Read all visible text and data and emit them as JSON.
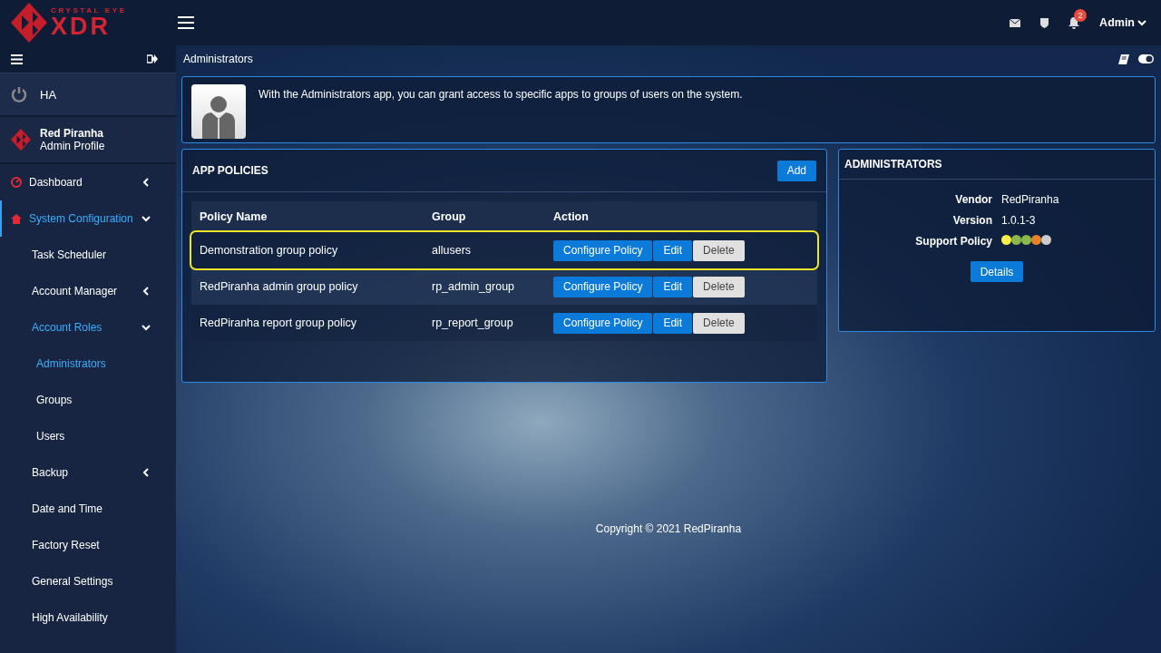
{
  "header": {
    "logo_top": "CRYSTAL EYE",
    "logo_main": "XDR",
    "notifications": "2",
    "user": "Admin"
  },
  "sidebar": {
    "ha": "HA",
    "profile": {
      "name": "Red Piranha",
      "role": "Admin Profile"
    },
    "items": [
      {
        "label": "Dashboard",
        "expanded": false,
        "selected": false
      },
      {
        "label": "System Configuration",
        "expanded": true,
        "selected": true,
        "children": [
          {
            "label": "Task Scheduler",
            "selected": false
          },
          {
            "label": "Account Manager",
            "expanded": false,
            "selected": false
          },
          {
            "label": "Account Roles",
            "expanded": true,
            "selected": true,
            "children": [
              {
                "label": "Administrators",
                "selected": true
              },
              {
                "label": "Groups",
                "selected": false
              },
              {
                "label": "Users",
                "selected": false
              }
            ]
          },
          {
            "label": "Backup",
            "expanded": false,
            "selected": false
          },
          {
            "label": "Date and Time",
            "selected": false
          },
          {
            "label": "Factory Reset",
            "selected": false
          },
          {
            "label": "General Settings",
            "selected": false
          },
          {
            "label": "High Availability",
            "selected": false
          }
        ]
      }
    ]
  },
  "breadcrumb": "Administrators",
  "intro": "With the Administrators app, you can grant access to specific apps to groups of users on the system.",
  "policies": {
    "title": "APP POLICIES",
    "add": "Add",
    "columns": [
      "Policy Name",
      "Group",
      "Action"
    ],
    "rows": [
      {
        "name": "Demonstration group policy",
        "group": "allusers",
        "highlighted": true,
        "configure": "Configure Policy",
        "edit": "Edit",
        "delete": "Delete"
      },
      {
        "name": "RedPiranha admin group policy",
        "group": "rp_admin_group",
        "highlighted": false,
        "configure": "Configure Policy",
        "edit": "Edit",
        "delete": "Delete"
      },
      {
        "name": "RedPiranha report group policy",
        "group": "rp_report_group",
        "highlighted": false,
        "configure": "Configure Policy",
        "edit": "Edit",
        "delete": "Delete"
      }
    ]
  },
  "info": {
    "title": "ADMINISTRATORS",
    "fields": [
      {
        "label": "Vendor",
        "value": "RedPiranha"
      },
      {
        "label": "Version",
        "value": "1.0.1-3"
      }
    ],
    "support_label": "Support Policy",
    "support_dots": [
      {
        "color": "#f5f04a"
      },
      {
        "color": "#8ab84a"
      },
      {
        "color": "#8ab84a"
      },
      {
        "color": "#e8822a"
      },
      {
        "color": "#cccccc"
      }
    ],
    "details": "Details"
  },
  "footer": "Copyright © 2021 RedPiranha"
}
